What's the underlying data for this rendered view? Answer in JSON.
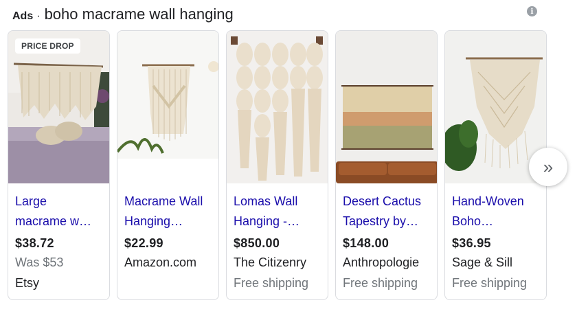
{
  "header": {
    "ads_label": "Ads",
    "separator": "·",
    "query": "boho macrame wall hanging",
    "info_icon": "info-icon"
  },
  "cards": [
    {
      "badge": "PRICE DROP",
      "title_line1": "Large",
      "title_line2": "macrame w…",
      "price": "$38.72",
      "line1": "Was $53",
      "line2": "Etsy"
    },
    {
      "title_line1": "Macrame Wall",
      "title_line2": "Hanging…",
      "price": "$22.99",
      "line1": "Amazon.com"
    },
    {
      "title_line1": "Lomas Wall",
      "title_line2": "Hanging -…",
      "price": "$850.00",
      "line1": "The Citizenry",
      "line2": "Free shipping"
    },
    {
      "title_line1": "Desert Cactus",
      "title_line2": "Tapestry by…",
      "price": "$148.00",
      "line1": "Anthropologie",
      "line2": "Free shipping"
    },
    {
      "title_line1": "Hand-Woven",
      "title_line2": "Boho…",
      "price": "$36.95",
      "line1": "Sage & Sill",
      "line2": "Free shipping"
    }
  ],
  "next_button": {
    "icon": "chevron-double-right-icon",
    "glyph": "»"
  },
  "colors": {
    "link": "#1a0dab",
    "text": "#202124",
    "muted": "#70757a",
    "border": "#dadce0"
  }
}
